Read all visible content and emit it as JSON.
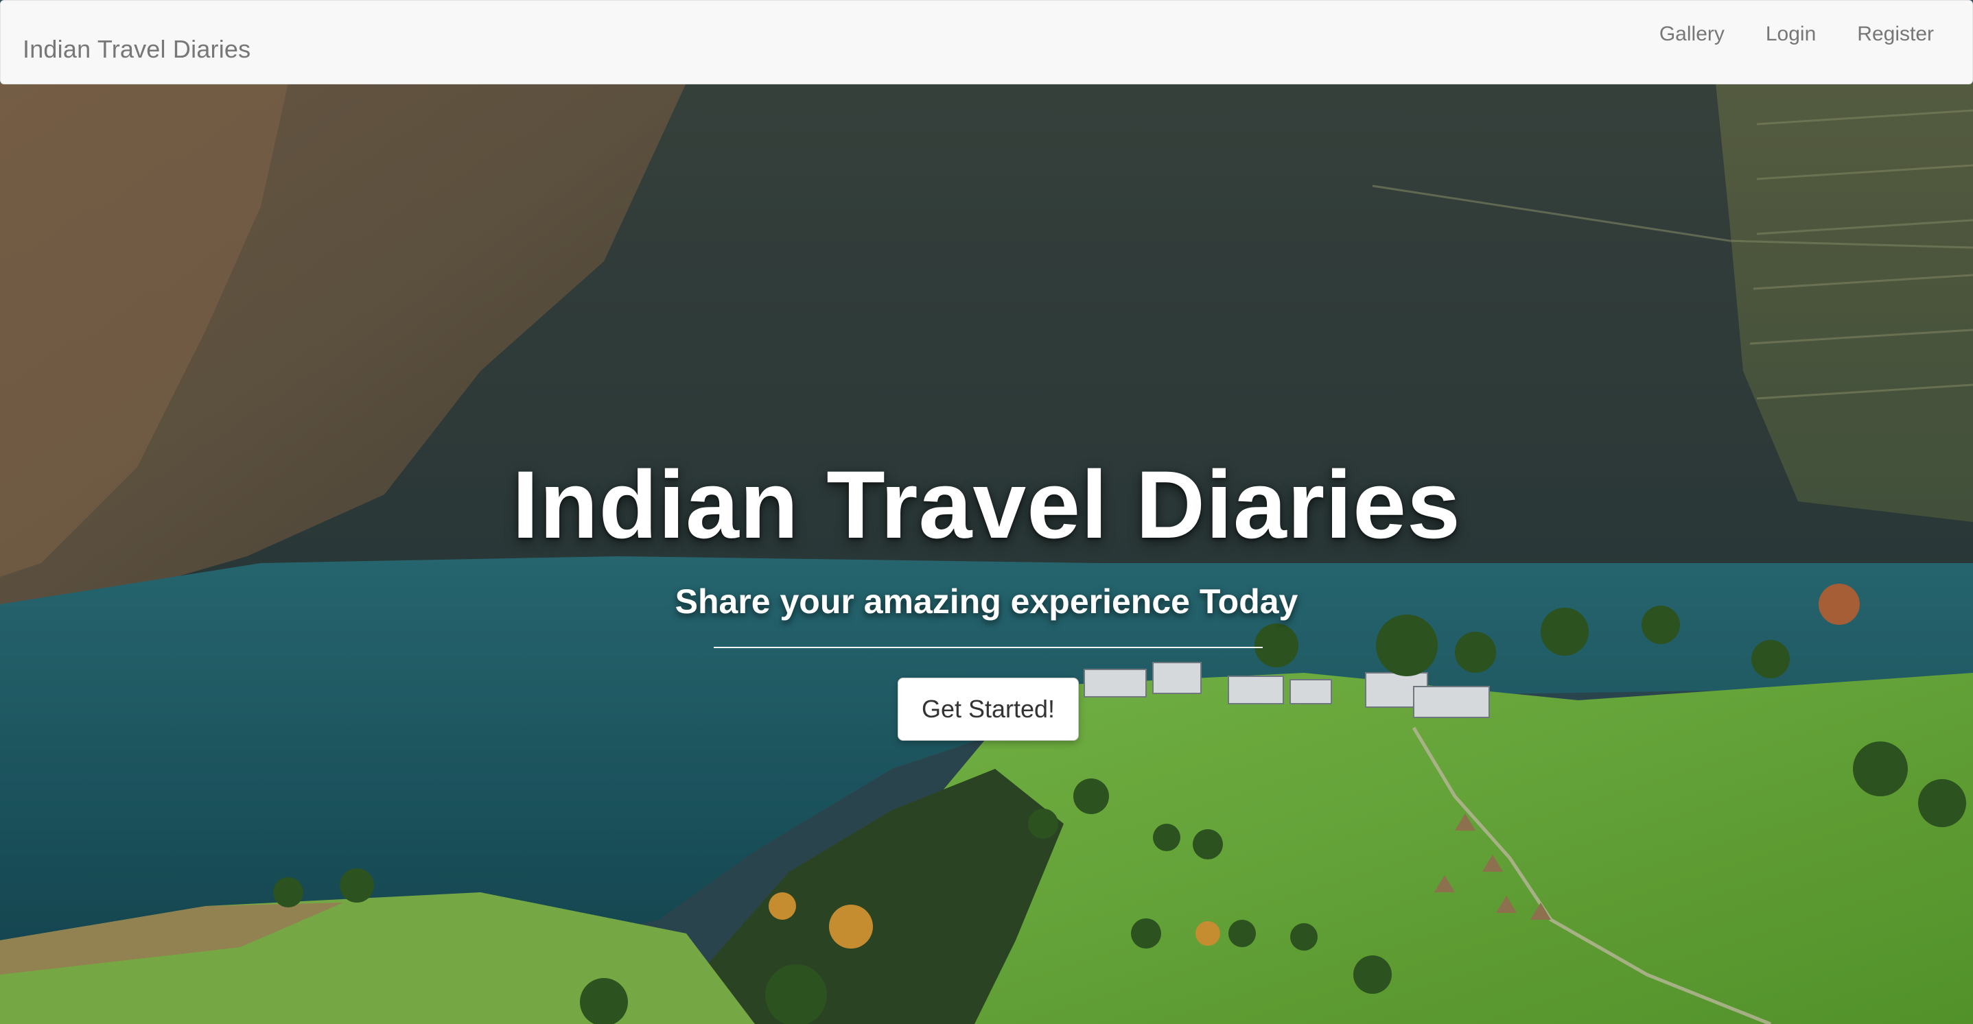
{
  "navbar": {
    "brand": "Indian Travel Diaries",
    "links": [
      {
        "label": "Gallery"
      },
      {
        "label": "Login"
      },
      {
        "label": "Register"
      }
    ]
  },
  "hero": {
    "title": "Indian Travel Diaries",
    "subtitle": "Share your amazing experience Today",
    "cta_label": "Get Started!"
  },
  "colors": {
    "navbar_bg": "#f8f8f8",
    "nav_text": "#777777",
    "hero_text": "#ffffff",
    "lake": "#1f5c66",
    "meadow": "#6fb43a",
    "mountain": "#3a4a45"
  }
}
